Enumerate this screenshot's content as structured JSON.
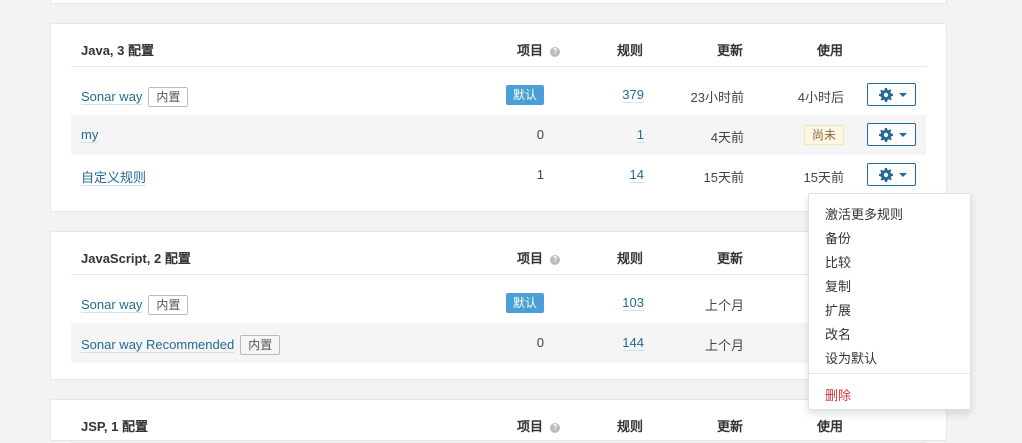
{
  "columns": {
    "projects": "项目",
    "rules": "规则",
    "updated": "更新",
    "used": "使用"
  },
  "colors": {
    "link": "#236a97",
    "default_badge": "#4b9fd5",
    "danger": "#d4333f"
  },
  "java": {
    "title": "Java, 3 配置",
    "profiles": [
      {
        "name": "Sonar way",
        "builtin": "内置",
        "projects_badge": "默认",
        "rules": "379",
        "updated": "23小时前",
        "used": "4小时后"
      },
      {
        "name": "my",
        "projects": "0",
        "rules": "1",
        "updated": "4天前",
        "used_badge": "尚未"
      },
      {
        "name": "自定义规则",
        "projects": "1",
        "rules": "14",
        "updated": "15天前",
        "used": "15天前"
      }
    ]
  },
  "javascript": {
    "title": "JavaScript, 2 配置",
    "profiles": [
      {
        "name": "Sonar way",
        "builtin": "内置",
        "projects_badge": "默认",
        "rules": "103",
        "updated": "上个月"
      },
      {
        "name": "Sonar way Recommended",
        "builtin": "内置",
        "projects": "0",
        "rules": "144",
        "updated": "上个月"
      }
    ]
  },
  "jsp": {
    "title": "JSP, 1 配置"
  },
  "actions_menu": {
    "items": [
      "激活更多规则",
      "备份",
      "比较",
      "复制",
      "扩展",
      "改名",
      "设为默认"
    ],
    "delete": "删除"
  },
  "icons": {
    "gear": "gear-icon",
    "caret": "caret-down-icon",
    "help": "help-icon"
  }
}
